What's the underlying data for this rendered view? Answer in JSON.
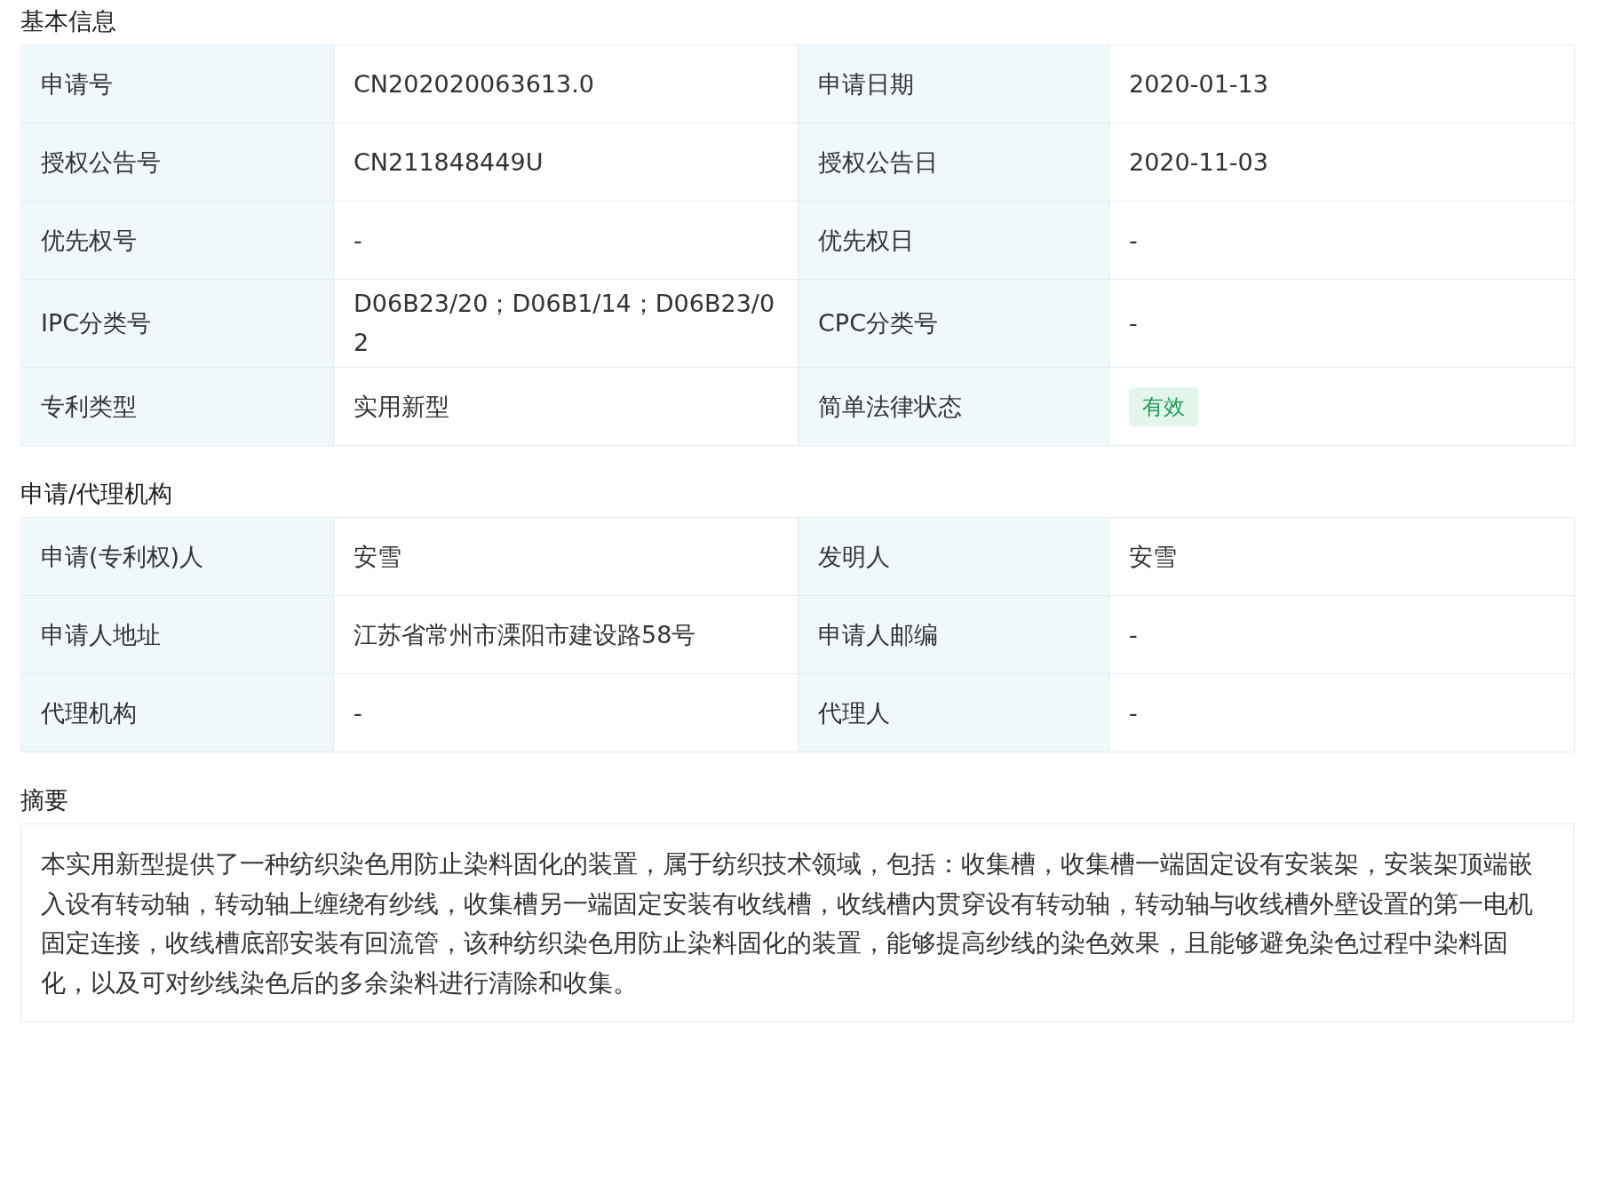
{
  "sections": [
    {
      "kind": "table",
      "title": "基本信息",
      "rows": [
        [
          {
            "label": "申请号",
            "value": "CN202020063613.0",
            "kind": "text"
          },
          {
            "label": "申请日期",
            "value": "2020-01-13",
            "kind": "text"
          }
        ],
        [
          {
            "label": "授权公告号",
            "value": "CN211848449U",
            "kind": "text"
          },
          {
            "label": "授权公告日",
            "value": "2020-11-03",
            "kind": "text"
          }
        ],
        [
          {
            "label": "优先权号",
            "value": "-",
            "kind": "text"
          },
          {
            "label": "优先权日",
            "value": "-",
            "kind": "text"
          }
        ],
        [
          {
            "label": "IPC分类号",
            "value": "D06B23/20；D06B1/14；D06B23/02",
            "kind": "text"
          },
          {
            "label": "CPC分类号",
            "value": "-",
            "kind": "text"
          }
        ],
        [
          {
            "label": "专利类型",
            "value": "实用新型",
            "kind": "text"
          },
          {
            "label": "简单法律状态",
            "value": "有效",
            "kind": "tag"
          }
        ]
      ]
    },
    {
      "kind": "table",
      "title": "申请/代理机构",
      "rows": [
        [
          {
            "label": "申请(专利权)人",
            "value": "安雪",
            "kind": "text"
          },
          {
            "label": "发明人",
            "value": "安雪",
            "kind": "text"
          }
        ],
        [
          {
            "label": "申请人地址",
            "value": "江苏省常州市溧阳市建设路58号",
            "kind": "text"
          },
          {
            "label": "申请人邮编",
            "value": "-",
            "kind": "text"
          }
        ],
        [
          {
            "label": "代理机构",
            "value": "-",
            "kind": "text"
          },
          {
            "label": "代理人",
            "value": "-",
            "kind": "text"
          }
        ]
      ]
    },
    {
      "kind": "text",
      "title": "摘要",
      "text": "本实用新型提供了一种纺织染色用防止染料固化的装置，属于纺织技术领域，包括：收集槽，收集槽一端固定设有安装架，安装架顶端嵌入设有转动轴，转动轴上缠绕有纱线，收集槽另一端固定安装有收线槽，收线槽内贯穿设有转动轴，转动轴与收线槽外壁设置的第一电机固定连接，收线槽底部安装有回流管，该种纺织染色用防止染料固化的装置，能够提高纱线的染色效果，且能够避免染色过程中染料固化，以及可对纱线染色后的多余染料进行清除和收集。"
    }
  ]
}
